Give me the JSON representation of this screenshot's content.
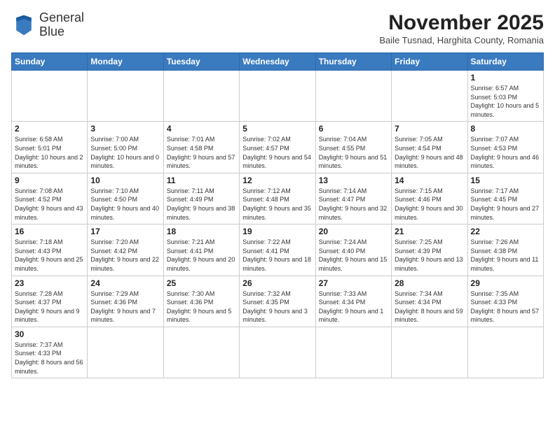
{
  "header": {
    "logo_line1": "General",
    "logo_line2": "Blue",
    "title": "November 2025",
    "subtitle": "Baile Tusnad, Harghita County, Romania"
  },
  "weekdays": [
    "Sunday",
    "Monday",
    "Tuesday",
    "Wednesday",
    "Thursday",
    "Friday",
    "Saturday"
  ],
  "weeks": [
    [
      {
        "day": "",
        "info": ""
      },
      {
        "day": "",
        "info": ""
      },
      {
        "day": "",
        "info": ""
      },
      {
        "day": "",
        "info": ""
      },
      {
        "day": "",
        "info": ""
      },
      {
        "day": "",
        "info": ""
      },
      {
        "day": "1",
        "info": "Sunrise: 6:57 AM\nSunset: 5:03 PM\nDaylight: 10 hours and 5 minutes."
      }
    ],
    [
      {
        "day": "2",
        "info": "Sunrise: 6:58 AM\nSunset: 5:01 PM\nDaylight: 10 hours and 2 minutes."
      },
      {
        "day": "3",
        "info": "Sunrise: 7:00 AM\nSunset: 5:00 PM\nDaylight: 10 hours and 0 minutes."
      },
      {
        "day": "4",
        "info": "Sunrise: 7:01 AM\nSunset: 4:58 PM\nDaylight: 9 hours and 57 minutes."
      },
      {
        "day": "5",
        "info": "Sunrise: 7:02 AM\nSunset: 4:57 PM\nDaylight: 9 hours and 54 minutes."
      },
      {
        "day": "6",
        "info": "Sunrise: 7:04 AM\nSunset: 4:55 PM\nDaylight: 9 hours and 51 minutes."
      },
      {
        "day": "7",
        "info": "Sunrise: 7:05 AM\nSunset: 4:54 PM\nDaylight: 9 hours and 48 minutes."
      },
      {
        "day": "8",
        "info": "Sunrise: 7:07 AM\nSunset: 4:53 PM\nDaylight: 9 hours and 46 minutes."
      }
    ],
    [
      {
        "day": "9",
        "info": "Sunrise: 7:08 AM\nSunset: 4:52 PM\nDaylight: 9 hours and 43 minutes."
      },
      {
        "day": "10",
        "info": "Sunrise: 7:10 AM\nSunset: 4:50 PM\nDaylight: 9 hours and 40 minutes."
      },
      {
        "day": "11",
        "info": "Sunrise: 7:11 AM\nSunset: 4:49 PM\nDaylight: 9 hours and 38 minutes."
      },
      {
        "day": "12",
        "info": "Sunrise: 7:12 AM\nSunset: 4:48 PM\nDaylight: 9 hours and 35 minutes."
      },
      {
        "day": "13",
        "info": "Sunrise: 7:14 AM\nSunset: 4:47 PM\nDaylight: 9 hours and 32 minutes."
      },
      {
        "day": "14",
        "info": "Sunrise: 7:15 AM\nSunset: 4:46 PM\nDaylight: 9 hours and 30 minutes."
      },
      {
        "day": "15",
        "info": "Sunrise: 7:17 AM\nSunset: 4:45 PM\nDaylight: 9 hours and 27 minutes."
      }
    ],
    [
      {
        "day": "16",
        "info": "Sunrise: 7:18 AM\nSunset: 4:43 PM\nDaylight: 9 hours and 25 minutes."
      },
      {
        "day": "17",
        "info": "Sunrise: 7:20 AM\nSunset: 4:42 PM\nDaylight: 9 hours and 22 minutes."
      },
      {
        "day": "18",
        "info": "Sunrise: 7:21 AM\nSunset: 4:41 PM\nDaylight: 9 hours and 20 minutes."
      },
      {
        "day": "19",
        "info": "Sunrise: 7:22 AM\nSunset: 4:41 PM\nDaylight: 9 hours and 18 minutes."
      },
      {
        "day": "20",
        "info": "Sunrise: 7:24 AM\nSunset: 4:40 PM\nDaylight: 9 hours and 15 minutes."
      },
      {
        "day": "21",
        "info": "Sunrise: 7:25 AM\nSunset: 4:39 PM\nDaylight: 9 hours and 13 minutes."
      },
      {
        "day": "22",
        "info": "Sunrise: 7:26 AM\nSunset: 4:38 PM\nDaylight: 9 hours and 11 minutes."
      }
    ],
    [
      {
        "day": "23",
        "info": "Sunrise: 7:28 AM\nSunset: 4:37 PM\nDaylight: 9 hours and 9 minutes."
      },
      {
        "day": "24",
        "info": "Sunrise: 7:29 AM\nSunset: 4:36 PM\nDaylight: 9 hours and 7 minutes."
      },
      {
        "day": "25",
        "info": "Sunrise: 7:30 AM\nSunset: 4:36 PM\nDaylight: 9 hours and 5 minutes."
      },
      {
        "day": "26",
        "info": "Sunrise: 7:32 AM\nSunset: 4:35 PM\nDaylight: 9 hours and 3 minutes."
      },
      {
        "day": "27",
        "info": "Sunrise: 7:33 AM\nSunset: 4:34 PM\nDaylight: 9 hours and 1 minute."
      },
      {
        "day": "28",
        "info": "Sunrise: 7:34 AM\nSunset: 4:34 PM\nDaylight: 8 hours and 59 minutes."
      },
      {
        "day": "29",
        "info": "Sunrise: 7:35 AM\nSunset: 4:33 PM\nDaylight: 8 hours and 57 minutes."
      }
    ],
    [
      {
        "day": "30",
        "info": "Sunrise: 7:37 AM\nSunset: 4:33 PM\nDaylight: 8 hours and 56 minutes."
      },
      {
        "day": "",
        "info": ""
      },
      {
        "day": "",
        "info": ""
      },
      {
        "day": "",
        "info": ""
      },
      {
        "day": "",
        "info": ""
      },
      {
        "day": "",
        "info": ""
      },
      {
        "day": "",
        "info": ""
      }
    ]
  ]
}
